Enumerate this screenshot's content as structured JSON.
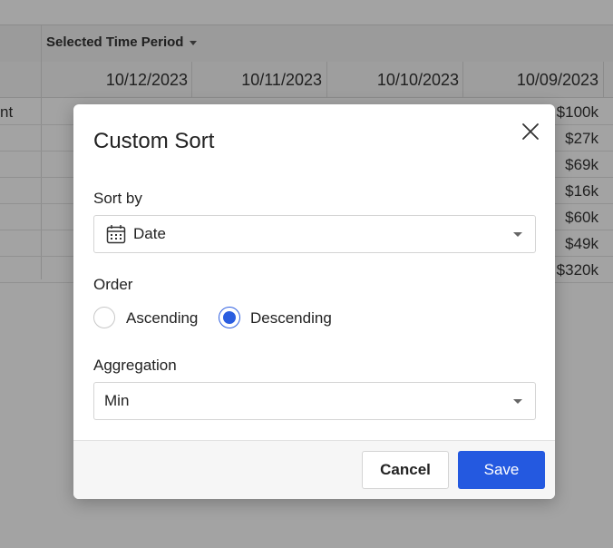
{
  "sheet": {
    "header_label": "Selected Time Period",
    "dates": [
      "10/12/2023",
      "10/11/2023",
      "10/10/2023",
      "10/09/2023"
    ],
    "row_label_fragment": "nt",
    "values_last_col": [
      "$100k",
      "$27k",
      "$69k",
      "$16k",
      "$60k",
      "$49k",
      "$320k"
    ]
  },
  "dialog": {
    "title": "Custom Sort",
    "sort_by": {
      "label": "Sort by",
      "value": "Date",
      "icon": "calendar-icon"
    },
    "order": {
      "label": "Order",
      "options": [
        {
          "label": "Ascending",
          "checked": false
        },
        {
          "label": "Descending",
          "checked": true
        }
      ]
    },
    "aggregation": {
      "label": "Aggregation",
      "value": "Min"
    },
    "buttons": {
      "cancel": "Cancel",
      "save": "Save"
    }
  },
  "colors": {
    "accent": "#2459e0",
    "overlay": "rgba(0,0,0,0.36)"
  }
}
